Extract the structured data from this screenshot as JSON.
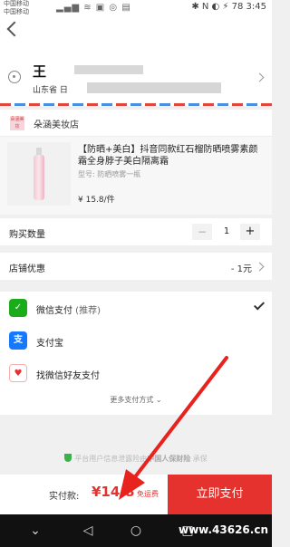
{
  "status_bar": {
    "carrier_1": "中国移动",
    "carrier_2": "中国移动",
    "right": "✱ N ◐ ⚡ 78 3:45"
  },
  "address": {
    "name": "王",
    "province": "山东省 日"
  },
  "shop": {
    "logo_text": "朵涵美妆",
    "name": "朵涵美妆店"
  },
  "product": {
    "title": "【防晒+美白】抖音同款红石榴防晒喷雾素颜霜全身脖子美白隔离霜",
    "spec": "型号: 防晒喷雾一瓶",
    "price": "¥ 15.8/件"
  },
  "quantity": {
    "label": "购买数量",
    "minus": "−",
    "value": "1",
    "plus": "+"
  },
  "coupon": {
    "label": "店铺优惠",
    "value": "- 1元"
  },
  "payment": {
    "methods": [
      {
        "icon": "✓",
        "label": "微信支付",
        "tag": " (推荐)",
        "color": "#1aad19"
      },
      {
        "icon": "支",
        "label": "支付宝",
        "tag": "",
        "color": "#1677ff"
      },
      {
        "icon": "♥",
        "label": "找微信好友支付",
        "tag": "",
        "color": "#e6322e"
      }
    ],
    "more": "更多支付方式 ⌄"
  },
  "insurance": {
    "text": "平台用户信息泄露险由",
    "company": "中国人保财险",
    "suffix": " 承保"
  },
  "paybar": {
    "total_label": "实付款:",
    "amount": "¥14.8",
    "free_shipping": "免运费",
    "submit": "立即支付"
  },
  "watermark": "www.43626.cn",
  "colors": {
    "accent": "#e6322e"
  }
}
